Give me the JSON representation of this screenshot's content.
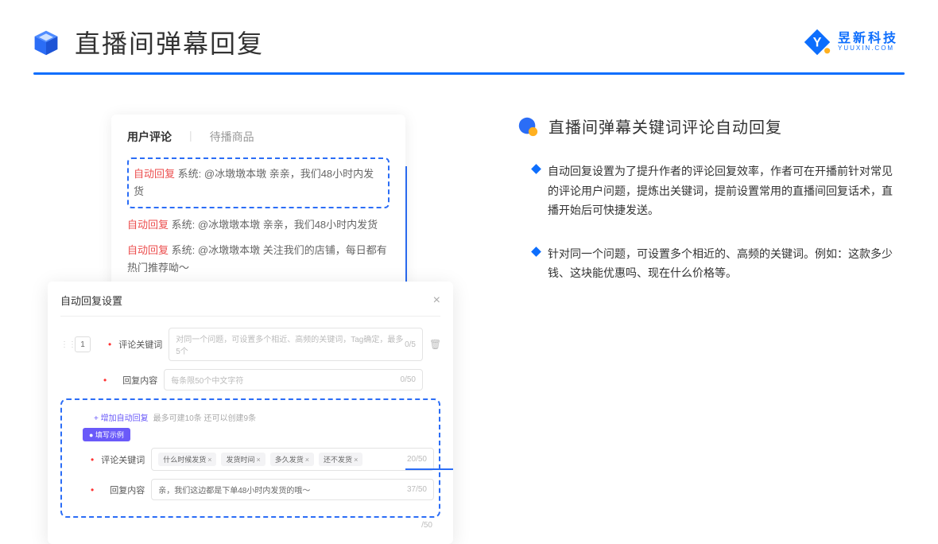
{
  "header": {
    "title": "直播间弹幕回复",
    "brand_name": "昱新科技",
    "brand_sub": "YUUXIN.COM"
  },
  "comments": {
    "tab_active": "用户评论",
    "tab_other": "待播商品",
    "auto_label": "自动回复",
    "sys_label": "系统:",
    "line1": "@冰墩墩本墩 亲亲，我们48小时内发货",
    "line2": "@冰墩墩本墩 亲亲，我们48小时内发货",
    "line3": "@冰墩墩本墩 关注我们的店铺，每日都有热门推荐呦～"
  },
  "modal": {
    "title": "自动回复设置",
    "seq": "1",
    "label_kw": "评论关键词",
    "ph_kw": "对同一个问题，可设置多个相近、高频的关键词，Tag确定，最多5个",
    "count_kw": "0/5",
    "label_content": "回复内容",
    "ph_content": "每条限50个中文字符",
    "count_content": "0/50",
    "add_link": "+ 增加自动回复",
    "add_hint": "最多可建10条 还可以创建9条",
    "example_badge": "● 填写示例",
    "ex_label_kw": "评论关键词",
    "ex_tags": [
      "什么时候发货",
      "发货时间",
      "多久发货",
      "还不发货"
    ],
    "ex_count_kw": "20/50",
    "ex_label_content": "回复内容",
    "ex_content": "亲，我们这边都是下单48小时内发货的哦～",
    "ex_count_content": "37/50",
    "foot_count": "/50"
  },
  "section": {
    "title": "直播间弹幕关键词评论自动回复",
    "bullets": [
      "自动回复设置为了提升作者的评论回复效率，作者可在开播前针对常见的评论用户问题，提炼出关键词，提前设置常用的直播间回复话术，直播开始后可快捷发送。",
      "针对同一个问题，可设置多个相近的、高频的关键词。例如：这款多少钱、这块能优惠吗、现在什么价格等。"
    ]
  }
}
